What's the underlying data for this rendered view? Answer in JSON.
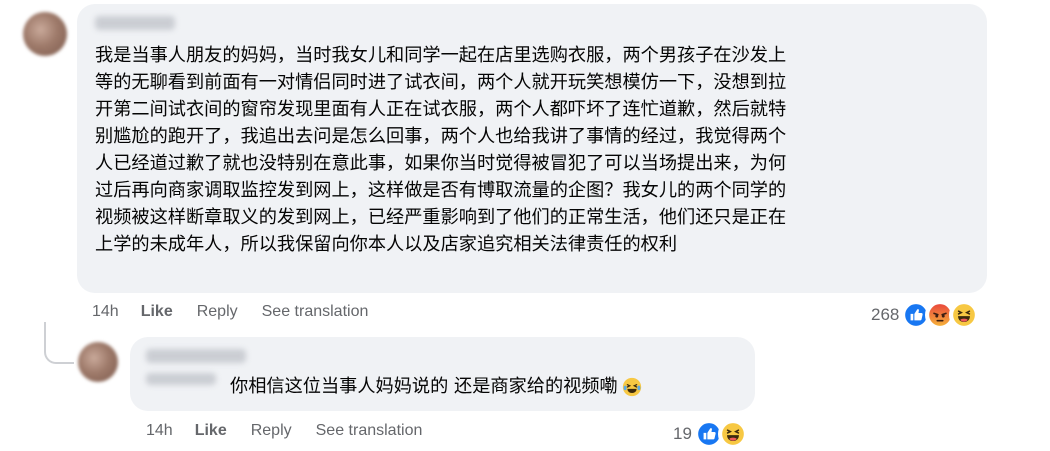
{
  "comment1": {
    "lines": [
      "我是当事人朋友的妈妈，当时我女儿和同学一起在店里选购衣服，两个男孩子在沙发上",
      "等的无聊看到前面有一对情侣同时进了试衣间，两个人就开玩笑想模仿一下，没想到拉",
      "开第二间试衣间的窗帘发现里面有人正在试衣服，两个人都吓坏了连忙道歉，然后就特",
      "别尴尬的跑开了，我追出去问是怎么回事，两个人也给我讲了事情的经过，我觉得两个",
      "人已经道过歉了就也没特别在意此事，如果你当时觉得被冒犯了可以当场提出来，为何",
      "过后再向商家调取监控发到网上，这样做是否有博取流量的企图？我女儿的两个同学的",
      "视频被这样断章取义的发到网上，已经严重影响到了他们的正常生活，他们还只是正在",
      "上学的未成年人，所以我保留向你本人以及店家追究相关法律责任的权利"
    ],
    "time": "14h",
    "like_label": "Like",
    "reply_label": "Reply",
    "translate_label": "See translation",
    "reaction_count": "268",
    "reaction_icons": [
      "like-icon",
      "angry-icon",
      "haha-icon"
    ]
  },
  "comment2": {
    "text": "你相信这位当事人妈妈说的 还是商家给的视频嘞",
    "emoji": "laughing-tears-emoji",
    "time": "14h",
    "like_label": "Like",
    "reply_label": "Reply",
    "translate_label": "See translation",
    "reaction_count": "19",
    "reaction_icons": [
      "like-icon",
      "haha-icon"
    ]
  },
  "colors": {
    "bubble": "#f0f2f5",
    "text": "#050505",
    "secondary": "#65676b",
    "like_blue": "#1877f2"
  }
}
